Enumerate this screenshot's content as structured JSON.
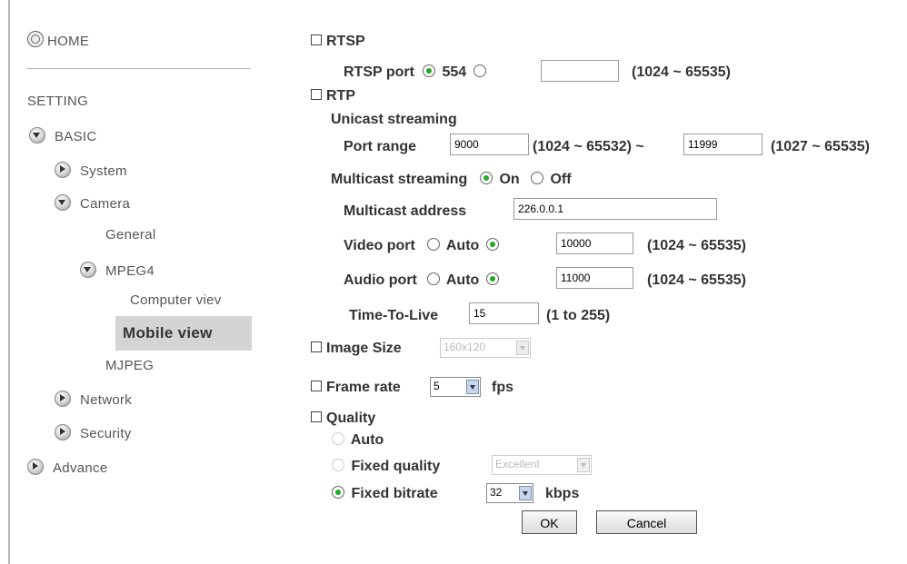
{
  "sidebar": {
    "home": "HOME",
    "setting": "SETTING",
    "basic": "BASIC",
    "system": "System",
    "camera": "Camera",
    "general": "General",
    "mpeg4": "MPEG4",
    "computer_view": "Computer viev",
    "mobile_view": "Mobile view",
    "mjpeg": "MJPEG",
    "network": "Network",
    "security": "Security",
    "advance": "Advance"
  },
  "rtsp": {
    "title": "RTSP",
    "port_label": "RTSP port",
    "default_port": "554",
    "custom_value": "",
    "range": "(1024 ~ 65535)"
  },
  "rtp": {
    "title": "RTP",
    "unicast_label": "Unicast streaming",
    "port_range_label": "Port range",
    "port_start": "9000",
    "start_range": "(1024 ~ 65532) ~",
    "port_end": "11999",
    "end_range": "(1027 ~ 65535)",
    "multicast_label": "Multicast streaming",
    "on_label": "On",
    "off_label": "Off",
    "multicast_address_label": "Multicast address",
    "multicast_address": "226.0.0.1",
    "video_port_label": "Video port",
    "audio_port_label": "Audio port",
    "auto_label": "Auto",
    "video_port": "10000",
    "audio_port": "11000",
    "port_range_hint": "(1024 ~ 65535)",
    "ttl_label": "Time-To-Live",
    "ttl_value": "15",
    "ttl_hint": "(1 to 255)"
  },
  "image_size": {
    "title": "Image Size",
    "value": "160x120"
  },
  "frame_rate": {
    "title": "Frame rate",
    "value": "5",
    "unit": "fps"
  },
  "quality": {
    "title": "Quality",
    "auto_label": "Auto",
    "fixed_quality_label": "Fixed quality",
    "fixed_quality_value": "Excellent",
    "fixed_bitrate_label": "Fixed bitrate",
    "bitrate_value": "32",
    "bitrate_unit": "kbps"
  },
  "buttons": {
    "ok": "OK",
    "cancel": "Cancel"
  }
}
